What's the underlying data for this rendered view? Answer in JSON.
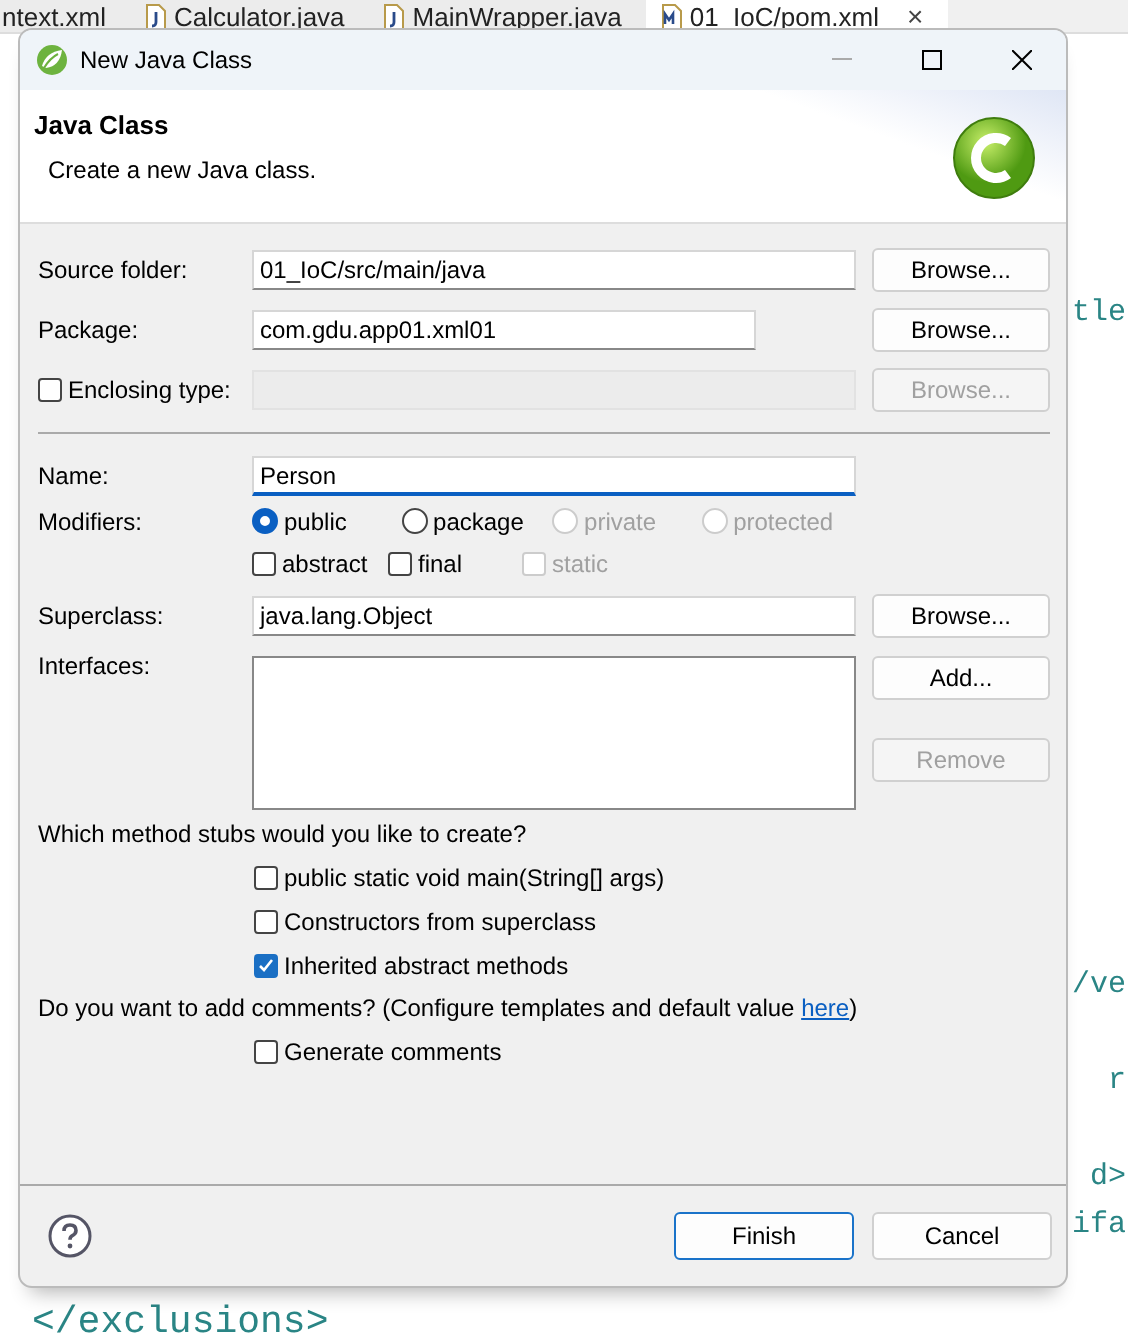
{
  "editor_tabs": [
    {
      "label": "ntext.xml",
      "kind": "plain",
      "selected": false
    },
    {
      "label": "Calculator.java",
      "kind": "java",
      "selected": false
    },
    {
      "label": "MainWrapper.java",
      "kind": "java",
      "selected": false
    },
    {
      "label": "01_IoC/pom.xml",
      "kind": "maven",
      "selected": true,
      "close": "×"
    }
  ],
  "editor_right_fragments": [
    "tle",
    "/ve",
    "r",
    "d>",
    "ifa"
  ],
  "editor_bottom_line": "</exclusions>",
  "dialog": {
    "title": "New Java Class",
    "header": {
      "title": "Java Class",
      "message": "Create a new Java class."
    },
    "source_folder": {
      "label": "Source folder:",
      "value": "01_IoC/src/main/java",
      "button": "Browse..."
    },
    "package": {
      "label": "Package:",
      "value": "com.gdu.app01.xml01",
      "button": "Browse..."
    },
    "enclosing_type": {
      "label": "Enclosing type:",
      "checked": false,
      "button": "Browse...",
      "disabled": true
    },
    "name": {
      "label": "Name:",
      "value": "Person",
      "focused": true
    },
    "modifiers": {
      "label": "Modifiers:",
      "access": [
        {
          "label": "public",
          "selected": true,
          "disabled": false
        },
        {
          "label": "package",
          "selected": false,
          "disabled": false
        },
        {
          "label": "private",
          "selected": false,
          "disabled": true
        },
        {
          "label": "protected",
          "selected": false,
          "disabled": true
        }
      ],
      "flags": [
        {
          "label": "abstract",
          "checked": false,
          "disabled": false
        },
        {
          "label": "final",
          "checked": false,
          "disabled": false
        },
        {
          "label": "static",
          "checked": false,
          "disabled": true
        }
      ]
    },
    "superclass": {
      "label": "Superclass:",
      "value": "java.lang.Object",
      "button": "Browse..."
    },
    "interfaces": {
      "label": "Interfaces:",
      "buttons": [
        {
          "label": "Add...",
          "disabled": false
        },
        {
          "label": "Remove",
          "disabled": true
        }
      ]
    },
    "stubs": {
      "question": "Which method stubs would you like to create?",
      "options": [
        {
          "label": "public static void main(String[] args)",
          "checked": false
        },
        {
          "label": "Constructors from superclass",
          "checked": false
        },
        {
          "label": "Inherited abstract methods",
          "checked": true
        }
      ]
    },
    "comments": {
      "question": "Do you want to add comments? (Configure templates and default value ",
      "link": "here",
      "after": ")",
      "options": [
        {
          "label": "Generate comments",
          "checked": false
        }
      ]
    },
    "footer": {
      "buttons": [
        {
          "label": "Finish",
          "default": true
        },
        {
          "label": "Cancel",
          "default": false
        }
      ]
    }
  }
}
